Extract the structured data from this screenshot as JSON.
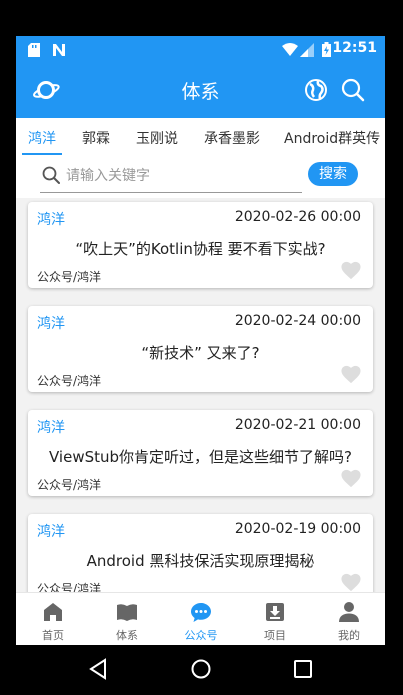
{
  "status_bar": {
    "time": "12:51"
  },
  "app_bar": {
    "title": "体系"
  },
  "tabs": [
    "鸿洋",
    "郭霖",
    "玉刚说",
    "承香墨影",
    "Android群英传"
  ],
  "search": {
    "placeholder": "请输入关键字",
    "value": "",
    "button_label": "搜索"
  },
  "articles": [
    {
      "author": "鸿洋",
      "date": "2020-02-26 00:00",
      "title": "“吹上天”的Kotlin协程 要不看下实战?",
      "chapter": "公众号/鸿洋"
    },
    {
      "author": "鸿洋",
      "date": "2020-02-24 00:00",
      "title": "“新技术” 又来了?",
      "chapter": "公众号/鸿洋"
    },
    {
      "author": "鸿洋",
      "date": "2020-02-21 00:00",
      "title": "ViewStub你肯定听过，但是这些细节了解吗?",
      "chapter": "公众号/鸿洋"
    },
    {
      "author": "鸿洋",
      "date": "2020-02-19 00:00",
      "title": "Android 黑科技保活实现原理揭秘",
      "chapter": "公众号/鸿洋"
    }
  ],
  "bottom_nav": [
    {
      "label": "首页",
      "icon": "home-icon"
    },
    {
      "label": "体系",
      "icon": "book-icon"
    },
    {
      "label": "公众号",
      "icon": "chat-icon"
    },
    {
      "label": "项目",
      "icon": "download-box-icon"
    },
    {
      "label": "我的",
      "icon": "person-icon"
    }
  ],
  "colors": {
    "primary": "#2196f3",
    "background": "#f2f2f2",
    "heart": "#dddddd"
  }
}
